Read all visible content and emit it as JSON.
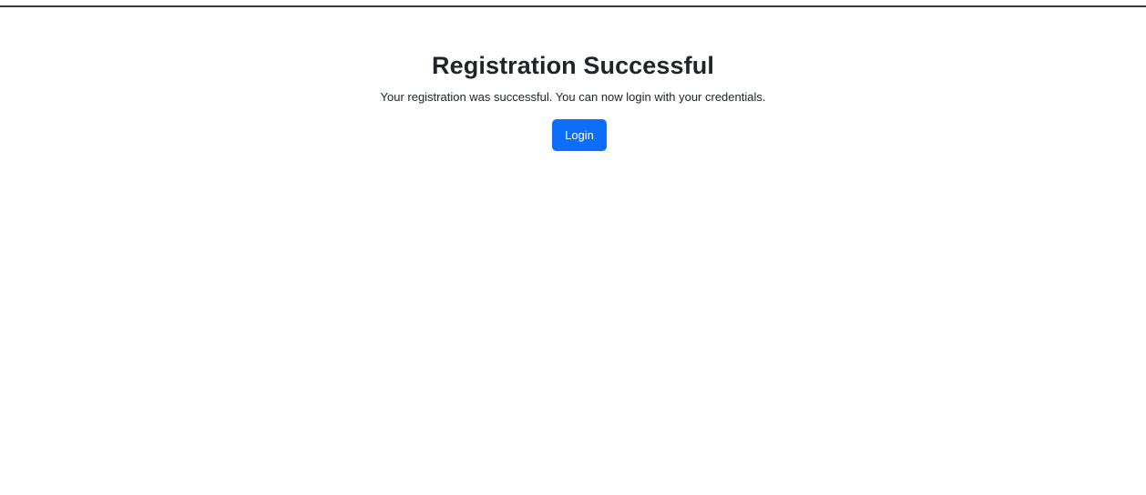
{
  "page": {
    "title": "Registration Successful",
    "message": "Your registration was successful. You can now login with your credentials."
  },
  "actions": {
    "login_label": "Login"
  },
  "colors": {
    "accent": "#0d6efd",
    "text": "#212529",
    "top_border": "#3a3a3a"
  }
}
